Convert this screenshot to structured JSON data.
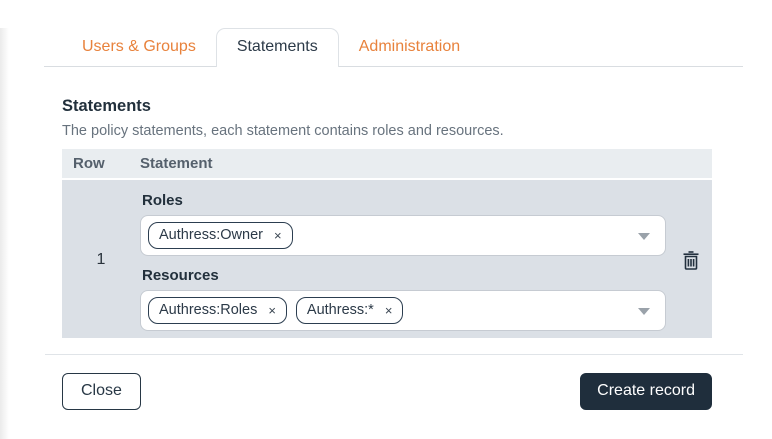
{
  "tabs": {
    "users_groups": "Users & Groups",
    "statements": "Statements",
    "administration": "Administration"
  },
  "section": {
    "title": "Statements",
    "description": "The policy statements, each statement contains roles and resources."
  },
  "table": {
    "headers": {
      "row": "Row",
      "statement": "Statement"
    },
    "rows": [
      {
        "number": "1",
        "roles": {
          "label": "Roles",
          "tags": [
            "Authress:Owner"
          ]
        },
        "resources": {
          "label": "Resources",
          "tags": [
            "Authress:Roles",
            "Authress:*"
          ]
        }
      }
    ]
  },
  "controls": {
    "remove_tag_glyph": "×"
  },
  "footer": {
    "close": "Close",
    "create": "Create record"
  },
  "colors": {
    "accent_orange": "#e8823c",
    "dark_navy": "#1f2e3c",
    "header_bg": "#e9edf0",
    "row_bg": "#dbe0e6"
  }
}
